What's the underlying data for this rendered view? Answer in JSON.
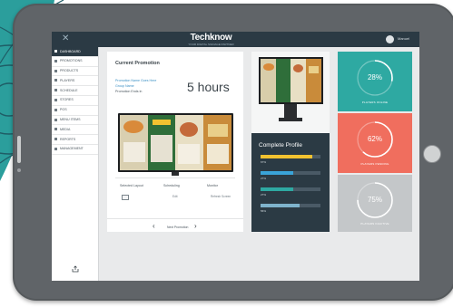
{
  "app": {
    "logo": "Techknow",
    "logo_tagline": "YOUR DIGITAL SIGNAGE PARTNER",
    "user_name": "Manuel"
  },
  "colors": {
    "topbar": "#2b3a44",
    "teal_card": "#2ea9a2",
    "coral_card": "#f06e5e",
    "gray_card": "#c4c7c9",
    "link": "#3a8fc4"
  },
  "sidebar": {
    "items": [
      {
        "label": "DASHBOARD",
        "icon": "dashboard-icon",
        "active": true
      },
      {
        "label": "PROMOTIONS",
        "icon": "promotions-icon",
        "active": false
      },
      {
        "label": "PRODUCTS",
        "icon": "products-icon",
        "active": false
      },
      {
        "label": "PLAYERS",
        "icon": "players-icon",
        "active": false
      },
      {
        "label": "SCHEDULE",
        "icon": "schedule-icon",
        "active": false
      },
      {
        "label": "STORES",
        "icon": "stores-icon",
        "active": false
      },
      {
        "label": "POS",
        "icon": "pos-icon",
        "active": false
      },
      {
        "label": "MENU ITEMS",
        "icon": "menu-items-icon",
        "active": false
      },
      {
        "label": "MEDIA",
        "icon": "media-icon",
        "active": false
      },
      {
        "label": "REPORTS",
        "icon": "reports-icon",
        "active": false
      },
      {
        "label": "MANAGEMENT",
        "icon": "management-icon",
        "active": false
      }
    ]
  },
  "promotion": {
    "title": "Current Promotion",
    "name_line": "Promotion Name Goes Here",
    "group_line": "Group Name",
    "meta_line": "Promotion Ends in",
    "hours": "5 hours",
    "col1_label": "Selected Layout",
    "col2_label": "Scheduling",
    "col3_label": "Monitor",
    "col2_sub": "Edit",
    "col3_sub": "Refresh Screen",
    "next_label": "Next Promotion"
  },
  "profile": {
    "title": "Complete Profile",
    "bars": [
      {
        "label": "67%",
        "value": 0.86,
        "color": "#f2c230"
      },
      {
        "label": "27%",
        "value": 0.55,
        "color": "#3aa4d9"
      },
      {
        "label": "27%",
        "value": 0.55,
        "color": "#2ea9a2"
      },
      {
        "label": "56%",
        "value": 0.65,
        "color": "#7fb3cc"
      }
    ]
  },
  "stats": [
    {
      "value": "28%",
      "label": "PLAYERS ONLINE",
      "color": "#2ea9a2",
      "progress": 0.28
    },
    {
      "value": "62%",
      "label": "PLAYERS PENDING",
      "color": "#f06e5e",
      "progress": 0.62
    },
    {
      "value": "75%",
      "label": "PLAYERS INACTIVE",
      "color": "#c4c7c9",
      "progress": 0.75
    }
  ]
}
